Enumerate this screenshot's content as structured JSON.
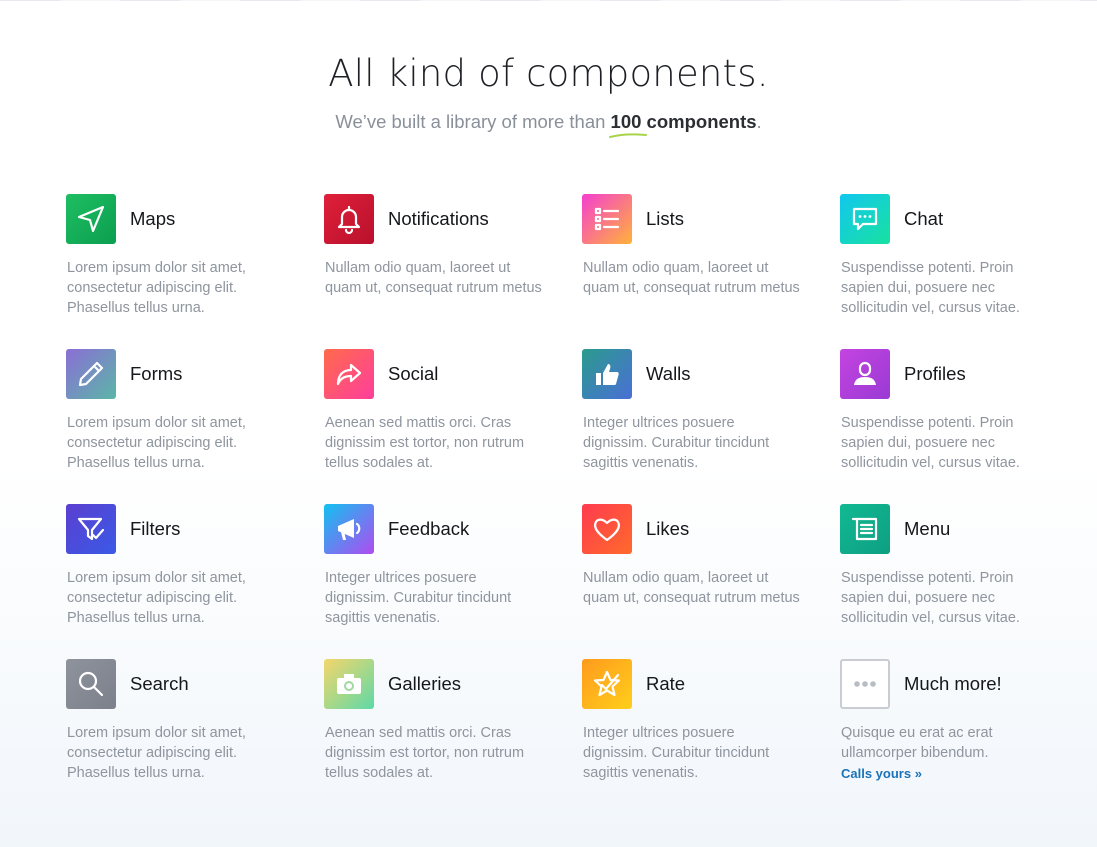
{
  "hero": {
    "title": "All kind of components.",
    "subtitle_pre": "We’ve built a library of more than ",
    "subtitle_number": "100",
    "subtitle_bold": " components",
    "subtitle_post": "."
  },
  "cards": [
    {
      "title": "Maps",
      "desc": "Lorem ipsum dolor sit amet, consectetur adipiscing elit. Phasellus tellus urna.",
      "icon": "navigation-arrow-icon",
      "colors": [
        "#1fbe62",
        "#0b9e4f"
      ]
    },
    {
      "title": "Notifications",
      "desc": "Nullam odio quam, laoreet ut quam ut, consequat rutrum metus",
      "icon": "bell-icon",
      "colors": [
        "#e0203a",
        "#b8102c"
      ]
    },
    {
      "title": "Lists",
      "desc": "Nullam odio quam, laoreet ut quam ut, consequat rutrum metus",
      "icon": "list-icon",
      "colors": [
        "#f43fd0",
        "#ffb23a"
      ]
    },
    {
      "title": "Chat",
      "desc": "Suspendisse potenti. Proin sapien dui, posuere nec sollicitudin vel, cursus vitae.",
      "icon": "chat-bubble-icon",
      "colors": [
        "#12c7ef",
        "#18e1a0"
      ]
    },
    {
      "title": "Forms",
      "desc": "Lorem ipsum dolor sit amet, consectetur adipiscing elit. Phasellus tellus urna.",
      "icon": "pencil-icon",
      "colors": [
        "#8b6ed6",
        "#5bb6a7"
      ]
    },
    {
      "title": "Social",
      "desc": "Aenean sed mattis orci. Cras dignissim est tortor, non rutrum tellus sodales at.",
      "icon": "share-arrow-icon",
      "colors": [
        "#ff6b4b",
        "#ff3e9c"
      ]
    },
    {
      "title": "Walls",
      "desc": "Integer ultrices posuere dignissim. Curabitur tincidunt sagittis venenatis.",
      "icon": "thumbs-up-icon",
      "colors": [
        "#2b9b8d",
        "#4a6fd6"
      ]
    },
    {
      "title": "Profiles",
      "desc": "Suspendisse potenti. Proin sapien dui, posuere nec sollicitudin vel, cursus vitae.",
      "icon": "user-icon",
      "colors": [
        "#c444e0",
        "#9a3ad4"
      ]
    },
    {
      "title": "Filters",
      "desc": "Lorem ipsum dolor sit amet, consectetur adipiscing elit. Phasellus tellus urna.",
      "icon": "filter-check-icon",
      "colors": [
        "#5b3fd0",
        "#3a5ae6"
      ]
    },
    {
      "title": "Feedback",
      "desc": "Integer ultrices posuere dignissim. Curabitur tincidunt sagittis venenatis.",
      "icon": "megaphone-icon",
      "colors": [
        "#12c1f0",
        "#b04bf0"
      ]
    },
    {
      "title": "Likes",
      "desc": "Nullam odio quam, laoreet ut quam ut, consequat rutrum metus",
      "icon": "heart-icon",
      "colors": [
        "#ff3b50",
        "#ff6a2b"
      ]
    },
    {
      "title": "Menu",
      "desc": "Suspendisse potenti. Proin sapien dui, posuere nec sollicitudin vel, cursus vitae.",
      "icon": "menu-list-icon",
      "colors": [
        "#12b993",
        "#0d9f82"
      ]
    },
    {
      "title": "Search",
      "desc": "Lorem ipsum dolor sit amet, consectetur adipiscing elit. Phasellus tellus urna.",
      "icon": "search-icon",
      "colors": [
        "#8e939c",
        "#7b808a"
      ]
    },
    {
      "title": "Galleries",
      "desc": "Aenean sed mattis orci. Cras dignissim est tortor, non rutrum tellus sodales at.",
      "icon": "camera-icon",
      "colors": [
        "#f5d66b",
        "#5ed9a6"
      ]
    },
    {
      "title": "Rate",
      "desc": "Integer ultrices posuere dignissim. Curabitur tincidunt sagittis venenatis.",
      "icon": "star-icon",
      "colors": [
        "#ff9a1e",
        "#ffcf1a"
      ]
    },
    {
      "title": "Much more!",
      "desc": "Quisque eu erat ac erat ullamcorper bibendum.",
      "icon": "ellipsis-icon",
      "colors": [
        "#ffffff",
        "#ffffff"
      ],
      "link": "Calls yours »"
    }
  ]
}
